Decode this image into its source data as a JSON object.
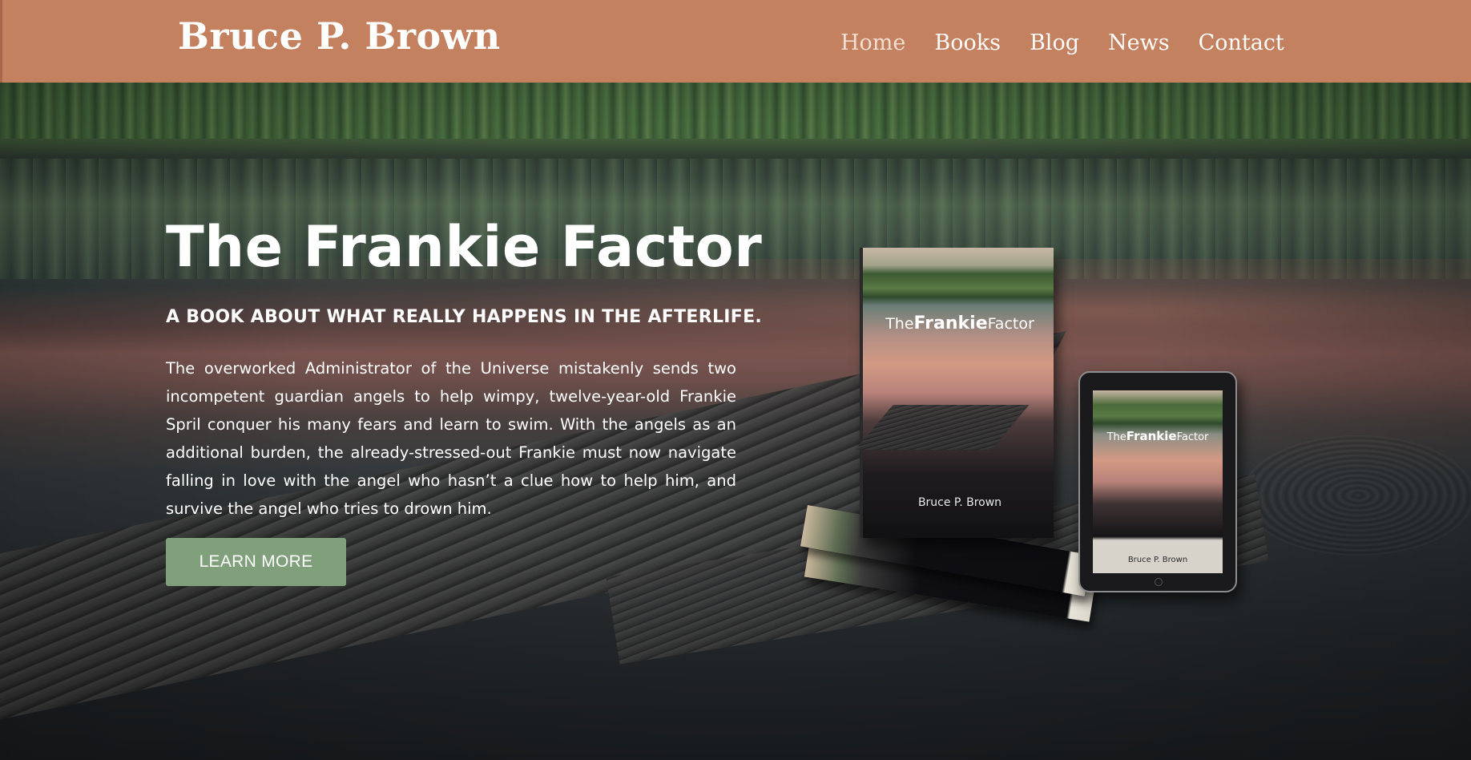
{
  "header": {
    "site_title": "Bruce P. Brown",
    "nav": [
      {
        "label": "Home",
        "active": true
      },
      {
        "label": "Books",
        "active": false
      },
      {
        "label": "Blog",
        "active": false
      },
      {
        "label": "News",
        "active": false
      },
      {
        "label": "Contact",
        "active": false
      }
    ]
  },
  "hero": {
    "title_prefix": "The ",
    "title_bold": "Frankie",
    "title_suffix": " Factor",
    "tagline": "A BOOK ABOUT WHAT REALLY HAPPENS IN THE AFTERLIFE.",
    "blurb": "The overworked Administrator of the Universe mistakenly sends two incompetent guardian angels to help wimpy, twelve-year-old Frankie Spril conquer his many fears and learn to swim. With the angels as an additional burden, the already-stressed-out Frankie must now navigate falling in love with the angel who hasn’t a clue how to help him, and survive the angel who tries to drown him.",
    "cta_label": "LEARN MORE"
  },
  "book_mockup": {
    "cover_title_prefix": "The",
    "cover_title_bold": "Frankie",
    "cover_title_suffix": "Factor",
    "author": "Bruce P. Brown"
  },
  "colors": {
    "header_bg": "#c4815f",
    "cta_bg": "#7fa07a"
  }
}
